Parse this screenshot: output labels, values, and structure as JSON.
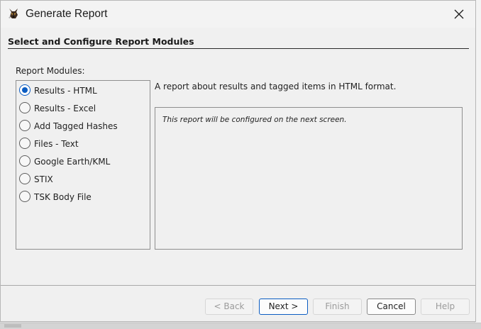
{
  "window": {
    "title": "Generate Report",
    "icon": "autopsy-dog-icon"
  },
  "section": {
    "title": "Select and Configure Report Modules"
  },
  "modules": {
    "label": "Report Modules:",
    "items": [
      {
        "label": "Results - HTML",
        "selected": true
      },
      {
        "label": "Results - Excel",
        "selected": false
      },
      {
        "label": "Add Tagged Hashes",
        "selected": false
      },
      {
        "label": "Files - Text",
        "selected": false
      },
      {
        "label": "Google Earth/KML",
        "selected": false
      },
      {
        "label": "STIX",
        "selected": false
      },
      {
        "label": "TSK Body File",
        "selected": false
      }
    ]
  },
  "details": {
    "description": "A report about results and tagged items in HTML format.",
    "config_note": "This report will be configured on the next screen."
  },
  "buttons": {
    "back": "< Back",
    "next": "Next >",
    "finish": "Finish",
    "cancel": "Cancel",
    "help": "Help"
  },
  "colors": {
    "accent": "#0b5cc2",
    "dialog_bg": "#f0f0f0",
    "disabled_text": "#9b9b9b"
  }
}
